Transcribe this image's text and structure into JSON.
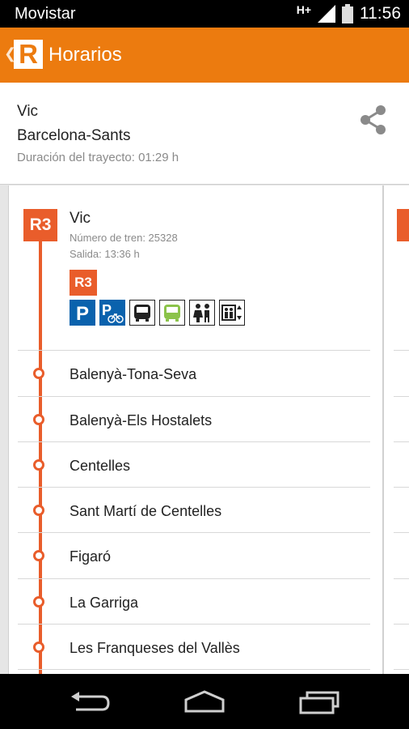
{
  "status": {
    "carrier": "Movistar",
    "network": "H+",
    "time": "11:56"
  },
  "appbar": {
    "logo": "R",
    "title": "Horarios"
  },
  "route": {
    "from": "Vic",
    "to": "Barcelona-Sants",
    "duration": "Duración del trayecto: 01:29 h"
  },
  "trip": {
    "line": "R3",
    "origin": "Vic",
    "train_number": "Número de tren: 25328",
    "departure": "Salida: 13:36 h",
    "line_badge": "R3",
    "services": [
      "parking-icon",
      "bike-parking-icon",
      "bus-icon",
      "green-bus-icon",
      "toilets-icon",
      "elevator-icon"
    ]
  },
  "stops": [
    "Balenyà-Tona-Seva",
    "Balenyà-Els Hostalets",
    "Centelles",
    "Sant Martí de Centelles",
    "Figaró",
    "La Garriga",
    "Les Franqueses del Vallès"
  ],
  "colors": {
    "accent": "#ec7b0f",
    "line_r3": "#e95d2b",
    "service_blue": "#0a62ad"
  }
}
